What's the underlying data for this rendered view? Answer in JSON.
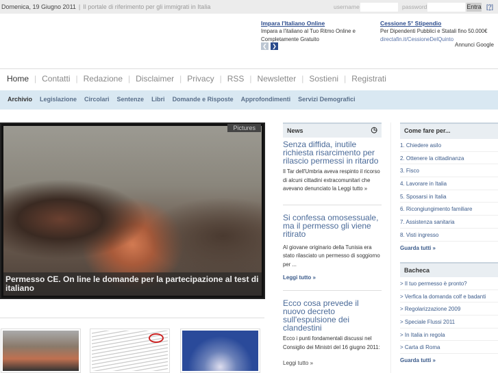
{
  "topbar": {
    "date": "Domenica, 19 Giugno 2011",
    "tagline": "Il portale di riferimento per gli immigrati in Italia",
    "username_label": "username",
    "password_label": "password",
    "login_button": "Entra",
    "help": "[?]"
  },
  "ads": [
    {
      "title": "Impara l'Italiano Online",
      "text": "Impara a l'italiano al Tuo Ritmo Online e Completamente Gratuito"
    },
    {
      "title": "Cessione 5° Stipendio",
      "text": "Per Dipendenti Pubblici e Statali fino 50.000€",
      "url": "directafin.it/CessioneDelQuinto"
    }
  ],
  "ads_label": "Annunci Google",
  "nav": [
    "Home",
    "Contatti",
    "Redazione",
    "Disclaimer",
    "Privacy",
    "RSS",
    "Newsletter",
    "Sostieni",
    "Registrati"
  ],
  "subnav": [
    "Archivio",
    "Legislazione",
    "Circolari",
    "Sentenze",
    "Libri",
    "Domande e Risposte",
    "Approfondimenti",
    "Servizi Demografici"
  ],
  "featured": {
    "badge": "Pictures",
    "caption": "Permesso CE. On line le domande per la partecipazione al test di italiano"
  },
  "news": {
    "title": "News",
    "items": [
      {
        "title": "Senza diffida, inutile richiesta risarcimento per rilascio permessi in ritardo",
        "text": "Il Tar dell'Umbria aveva respinto il ricorso di alcuni cittadini extracomunitari che avevano denunciato la Leggi tutto »"
      },
      {
        "title": "Si confessa omosessuale, ma il permesso gli viene ritirato",
        "text": "Al giovane originario della Tunisia era stato rilasciato un permesso di soggiorno per ...",
        "more": "Leggi tutto »"
      },
      {
        "title": "Ecco cosa prevede il nuovo decreto sull'espulsione dei clandestini",
        "text": "Ecco i punti fondamentali discussi nel Consiglio dei Ministri del 16 giugno 2011:",
        "more": "Leggi tutto »"
      }
    ]
  },
  "come_fare": {
    "title": "Come fare per...",
    "items": [
      "1. Chiedere asilo",
      "2. Ottenere la cittadinanza",
      "3. Fisco",
      "4. Lavorare in Italia",
      "5. Sposarsi in Italia",
      "6. Ricongiungimento familiare",
      "7. Assistenza sanitaria",
      "8. Visti ingresso"
    ],
    "all": "Guarda tutti »"
  },
  "bacheca": {
    "title": "Bacheca",
    "items": [
      "> Il tuo permesso è pronto?",
      "> Verfica la domanda colf e badanti",
      "> Regolarizzazione 2009",
      "> Speciale Flussi 2011",
      "> In Italia in regola",
      "> Carta di Roma"
    ],
    "all": "Guarda tutti »"
  }
}
